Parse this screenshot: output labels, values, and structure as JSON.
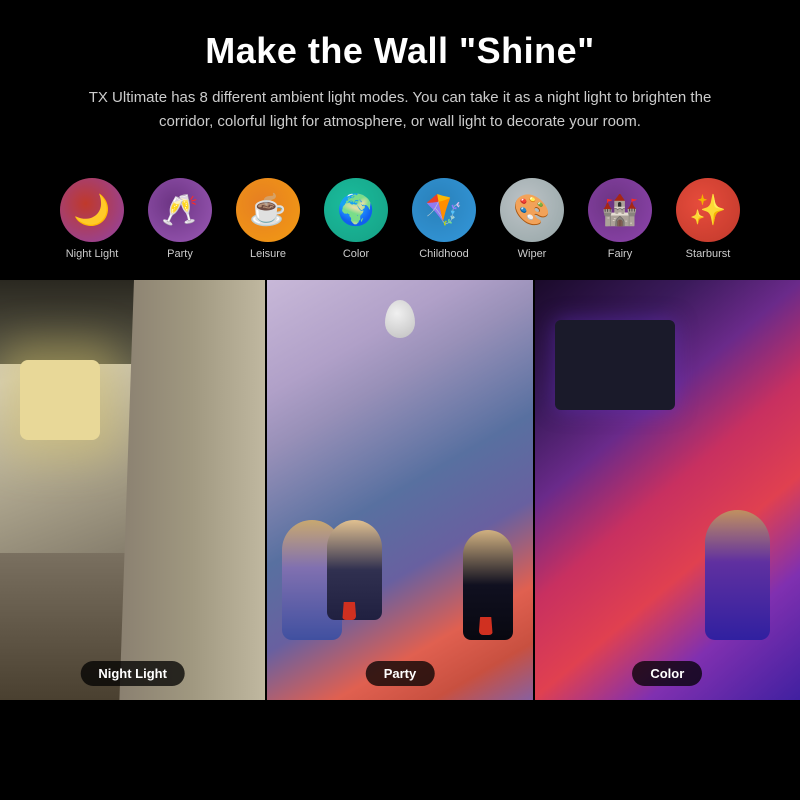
{
  "header": {
    "title": "Make the Wall \"Shine\"",
    "subtitle": "TX Ultimate has 8 different ambient light modes. You can take it as a night light to brighten the corridor, colorful light for atmosphere, or wall light to decorate your room."
  },
  "modes": [
    {
      "id": "night-light",
      "label": "Night Light",
      "icon": "🌙",
      "circle_class": "circle-night",
      "emoji": "🌙"
    },
    {
      "id": "party",
      "label": "Party",
      "icon": "🥂",
      "circle_class": "circle-party",
      "emoji": "🥂"
    },
    {
      "id": "leisure",
      "label": "Leisure",
      "icon": "☕",
      "circle_class": "circle-leisure",
      "emoji": "☕"
    },
    {
      "id": "color",
      "label": "Color",
      "icon": "🌍",
      "circle_class": "circle-color",
      "emoji": "🌍"
    },
    {
      "id": "childhood",
      "label": "Childhood",
      "icon": "🪁",
      "circle_class": "circle-childhood",
      "emoji": "🪁"
    },
    {
      "id": "wiper",
      "label": "Wiper",
      "icon": "🎨",
      "circle_class": "circle-wiper",
      "emoji": "🎨"
    },
    {
      "id": "fairy",
      "label": "Fairy",
      "icon": "🏰",
      "circle_class": "circle-fairy",
      "emoji": "🏰"
    },
    {
      "id": "starburst",
      "label": "Starburst",
      "icon": "✨",
      "circle_class": "circle-starburst",
      "emoji": "✨"
    }
  ],
  "panels": [
    {
      "id": "panel-night",
      "label": "Night Light"
    },
    {
      "id": "panel-party",
      "label": "Party"
    },
    {
      "id": "panel-color",
      "label": "Color"
    }
  ]
}
